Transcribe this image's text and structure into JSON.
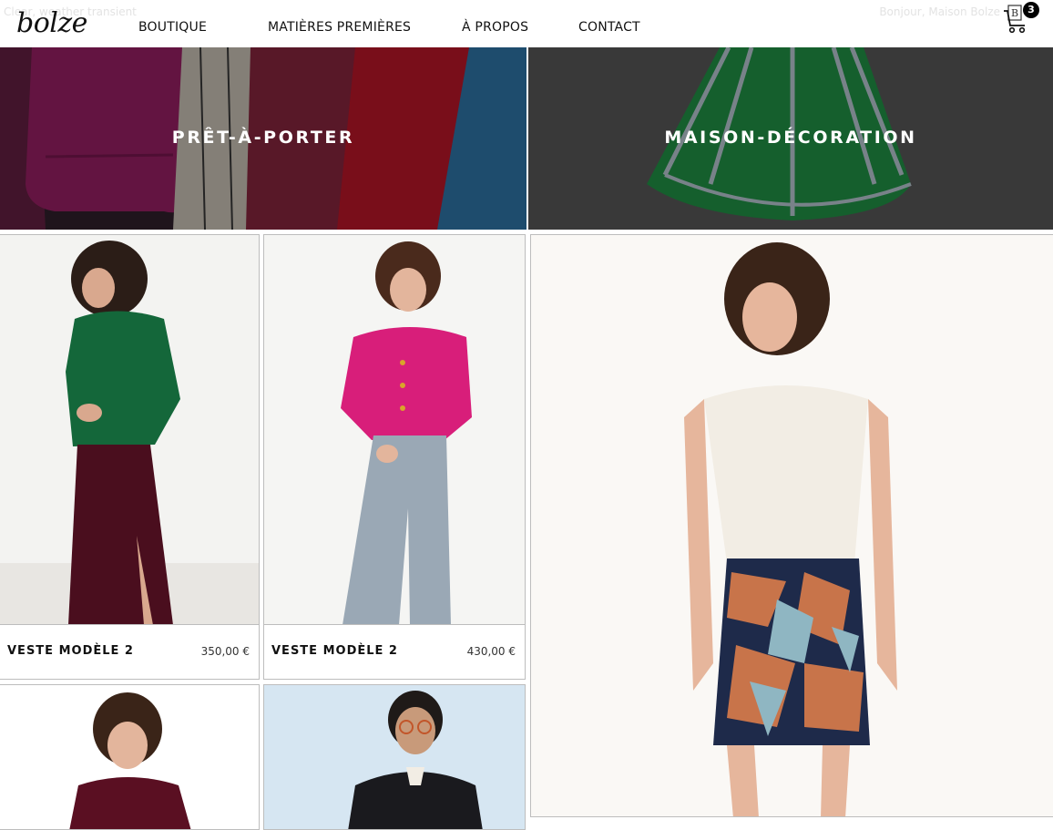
{
  "header": {
    "ghost_left": "Clear, weather transient",
    "ghost_right": "Bonjour, Maison Bolze",
    "logo": "bolze",
    "nav": [
      "BOUTIQUE",
      "MATIÈRES PREMIÈRES",
      "À PROPOS",
      "CONTACT"
    ],
    "cart_label": "B",
    "cart_count": "3"
  },
  "categories": [
    {
      "label": "PRÊT-À-PORTER"
    },
    {
      "label": "MAISON-DÉCORATION"
    }
  ],
  "products": [
    {
      "name": "VESTE MODÈLE 2",
      "price": "350,00 €",
      "image": "woman in green jacket and burgundy skirt"
    },
    {
      "name": "VESTE MODÈLE 2",
      "price": "430,00 €",
      "image": "woman in pink cardigan and jeans"
    }
  ],
  "colors": {
    "accent": "#000000",
    "border": "#bdbdbd",
    "text": "#111111"
  }
}
